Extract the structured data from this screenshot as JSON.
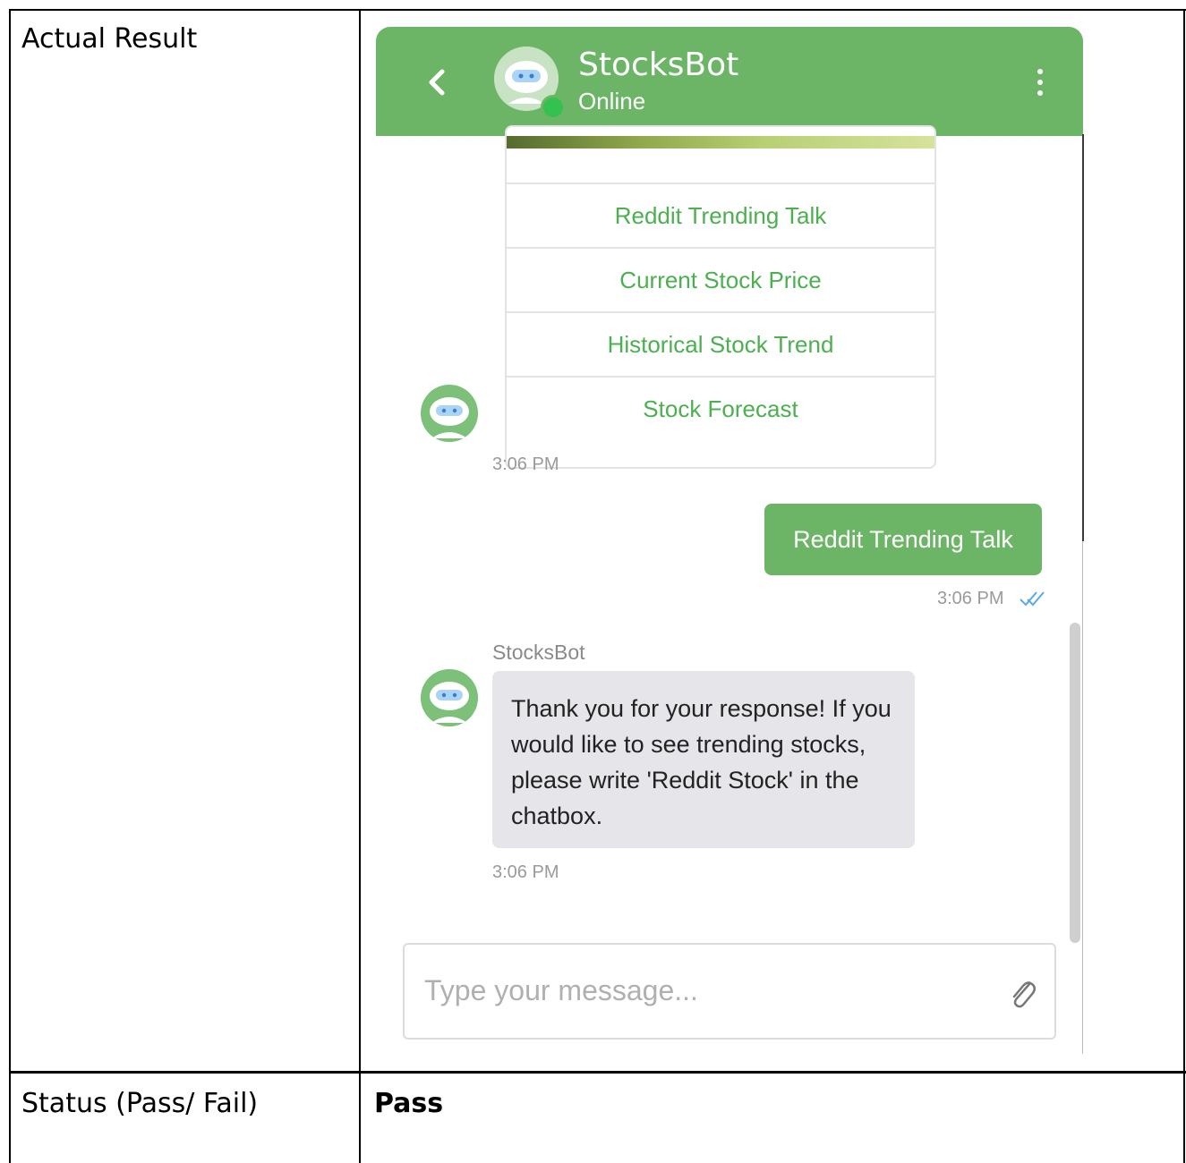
{
  "table": {
    "row1_label": "Actual Result",
    "row2_label": "Status (Pass/ Fail)",
    "row2_value": "Pass"
  },
  "chat": {
    "header": {
      "bot_name": "StocksBot",
      "status": "Online",
      "back_icon": "chevron-left-icon",
      "menu_icon": "kebab-menu-icon"
    },
    "options": [
      {
        "label": "Reddit Trending Talk"
      },
      {
        "label": "Current Stock Price"
      },
      {
        "label": "Historical Stock Trend"
      },
      {
        "label": "Stock Forecast"
      }
    ],
    "options_time": "3:06 PM",
    "user_message": {
      "text": "Reddit Trending Talk",
      "time": "3:06 PM"
    },
    "bot_message": {
      "sender": "StocksBot",
      "text": "Thank you for your response! If you would like to see trending stocks, please write 'Reddit Stock' in the chatbox.",
      "time": "3:06 PM"
    },
    "input": {
      "placeholder": "Type your message...",
      "value": ""
    },
    "colors": {
      "brand_green": "#6db566",
      "option_text_green": "#4caf50",
      "online_dot": "#33c24f",
      "bot_bubble": "#e5e5ea",
      "read_check": "#5aa9e6"
    }
  }
}
